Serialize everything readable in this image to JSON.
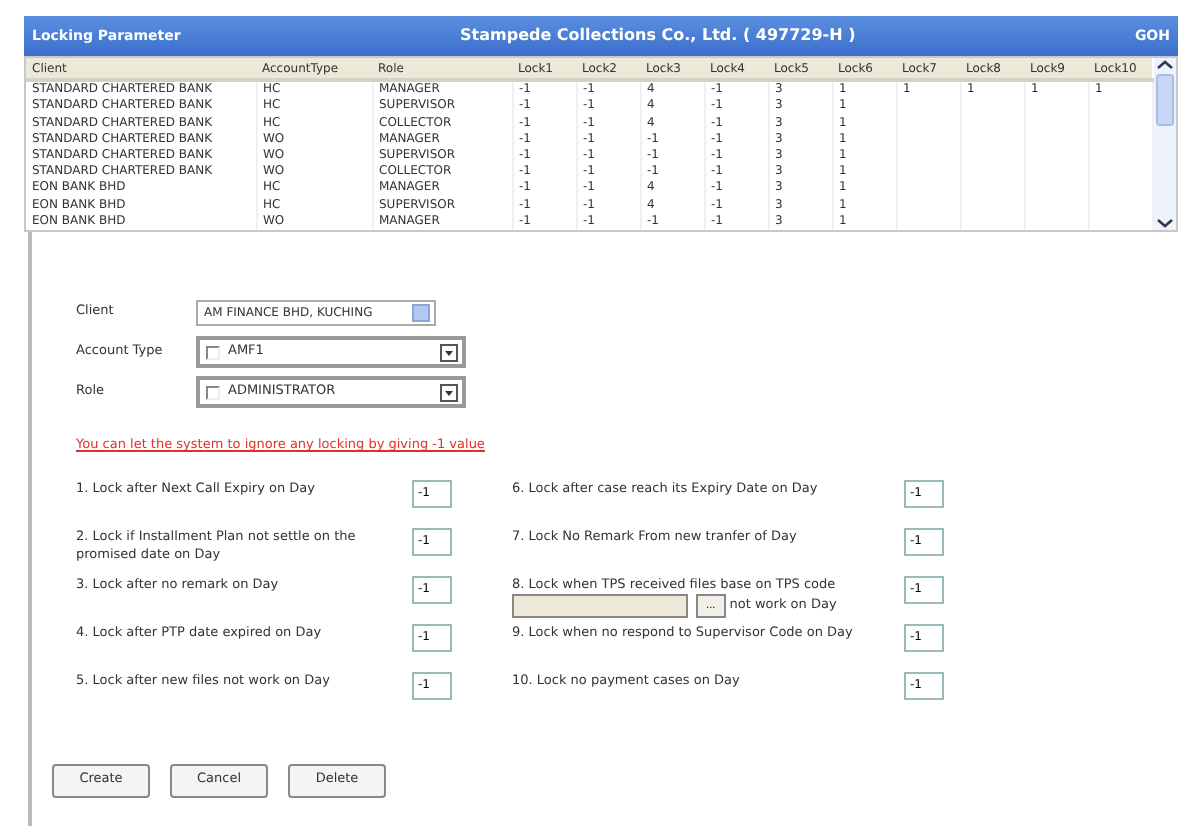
{
  "window": {
    "title": "Locking Parameter",
    "company": "Stampede Collections Co., Ltd. ( 497729-H )",
    "user": "GOH"
  },
  "table": {
    "columns": [
      "Client",
      "AccountType",
      "Role",
      "Lock1",
      "Lock2",
      "Lock3",
      "Lock4",
      "Lock5",
      "Lock6",
      "Lock7",
      "Lock8",
      "Lock9",
      "Lock10"
    ],
    "rows": [
      [
        "STANDARD CHARTERED BANK",
        "HC",
        "MANAGER",
        "-1",
        "-1",
        "4",
        "-1",
        "3",
        "1",
        "1",
        "1",
        "1",
        "1"
      ],
      [
        "STANDARD CHARTERED BANK",
        "HC",
        "SUPERVISOR",
        "-1",
        "-1",
        "4",
        "-1",
        "3",
        "1"
      ],
      [
        "STANDARD CHARTERED BANK",
        "HC",
        "COLLECTOR",
        "-1",
        "-1",
        "4",
        "-1",
        "3",
        "1"
      ],
      [
        "STANDARD CHARTERED BANK",
        "WO",
        "MANAGER",
        "-1",
        "-1",
        "-1",
        "-1",
        "3",
        "1"
      ],
      [
        "STANDARD CHARTERED BANK",
        "WO",
        "SUPERVISOR",
        "-1",
        "-1",
        "-1",
        "-1",
        "3",
        "1"
      ],
      [
        "STANDARD CHARTERED BANK",
        "WO",
        "COLLECTOR",
        "-1",
        "-1",
        "-1",
        "-1",
        "3",
        "1"
      ],
      [
        "EON BANK BHD",
        "HC",
        "MANAGER",
        "-1",
        "-1",
        "4",
        "-1",
        "3",
        "1"
      ],
      [
        "EON BANK BHD",
        "HC",
        "SUPERVISOR",
        "-1",
        "-1",
        "4",
        "-1",
        "3",
        "1"
      ],
      [
        "EON BANK BHD",
        "WO",
        "MANAGER",
        "-1",
        "-1",
        "-1",
        "-1",
        "3",
        "1"
      ]
    ]
  },
  "form": {
    "fields": [
      {
        "label": "Client",
        "value": "AM FINANCE BHD, KUCHING",
        "kind": "select"
      },
      {
        "label": "Account Type",
        "value": "AMF1",
        "kind": "checklist"
      },
      {
        "label": "Role",
        "value": "ADMINISTRATOR",
        "kind": "checklist"
      }
    ],
    "note": "You can let the system to ignore any locking by giving -1 value",
    "rules_left": [
      {
        "label": "1. Lock after Next Call Expiry on Day",
        "value": "-1",
        "kind": "plain"
      },
      {
        "label": "2. Lock if Installment Plan not settle on the promised date on Day",
        "value": "-1",
        "kind": "plain"
      },
      {
        "label": "3. Lock after no remark on Day",
        "value": "-1",
        "kind": "plain"
      },
      {
        "label": "4. Lock after PTP date expired on Day",
        "value": "-1",
        "kind": "plain"
      },
      {
        "label": "5. Lock after new files not work on Day",
        "value": "-1",
        "kind": "plain"
      }
    ],
    "rules_right": [
      {
        "label": "6. Lock after case reach its Expiry Date on Day",
        "value": "-1",
        "kind": "plain"
      },
      {
        "label": "7. Lock No Remark From new tranfer of Day",
        "value": "-1",
        "kind": "plain"
      },
      {
        "label": "8. Lock when TPS received files base on TPS code",
        "suffix": "not work on Day",
        "browse": "...",
        "value": "-1",
        "kind": "tps"
      },
      {
        "label": "9. Lock when no respond to Supervisor Code on Day",
        "value": "-1",
        "kind": "plain"
      },
      {
        "label": "10. Lock no payment cases on Day",
        "value": "-1",
        "kind": "plain"
      }
    ]
  },
  "buttons": [
    "Create",
    "Cancel",
    "Delete"
  ]
}
